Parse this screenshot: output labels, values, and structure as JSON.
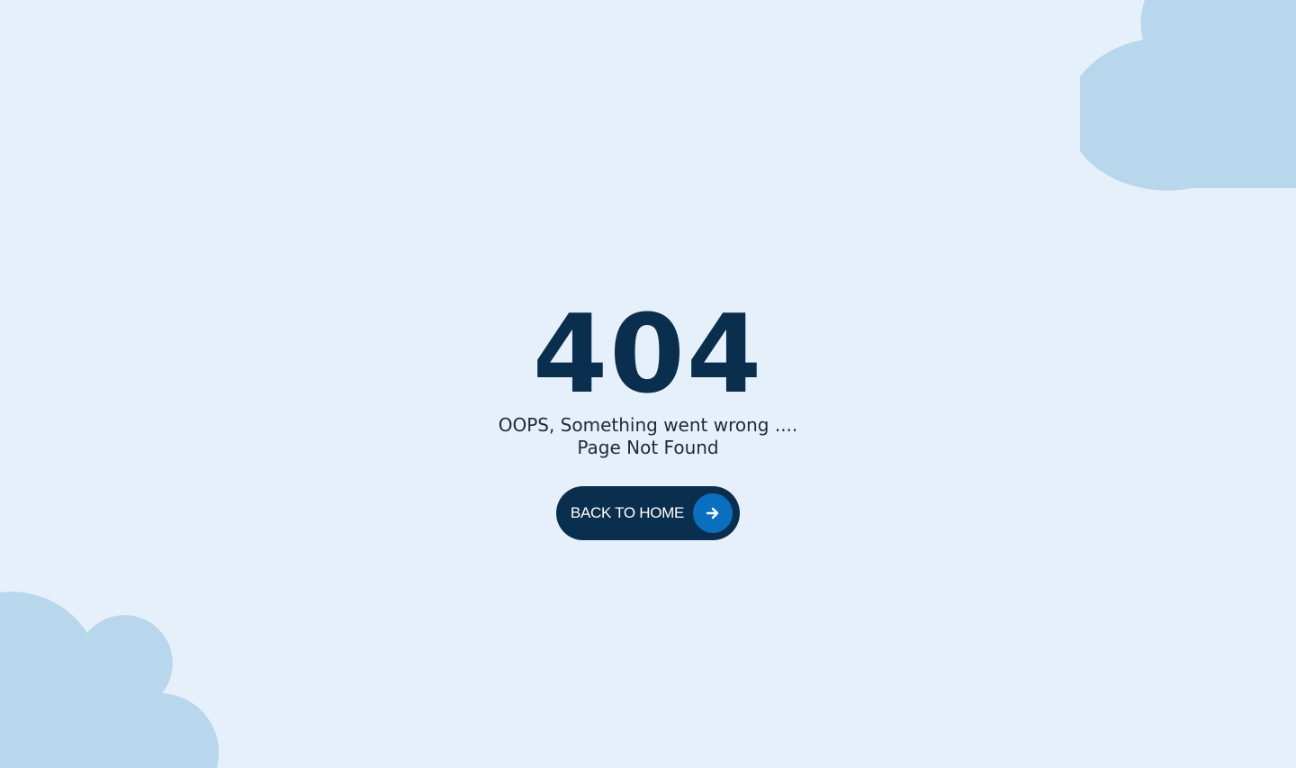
{
  "error": {
    "code": "404",
    "line1": "OOPS, Something went wrong ....",
    "line2": "Page Not Found"
  },
  "actions": {
    "back_home_label": "BACK TO HOME",
    "back_home_icon": "arrow-right-icon"
  },
  "colors": {
    "background": "#e6f0fa",
    "cloud": "#b8d7ec",
    "primary_dark": "#0a2e4d",
    "accent_blue": "#0b6fbf"
  }
}
